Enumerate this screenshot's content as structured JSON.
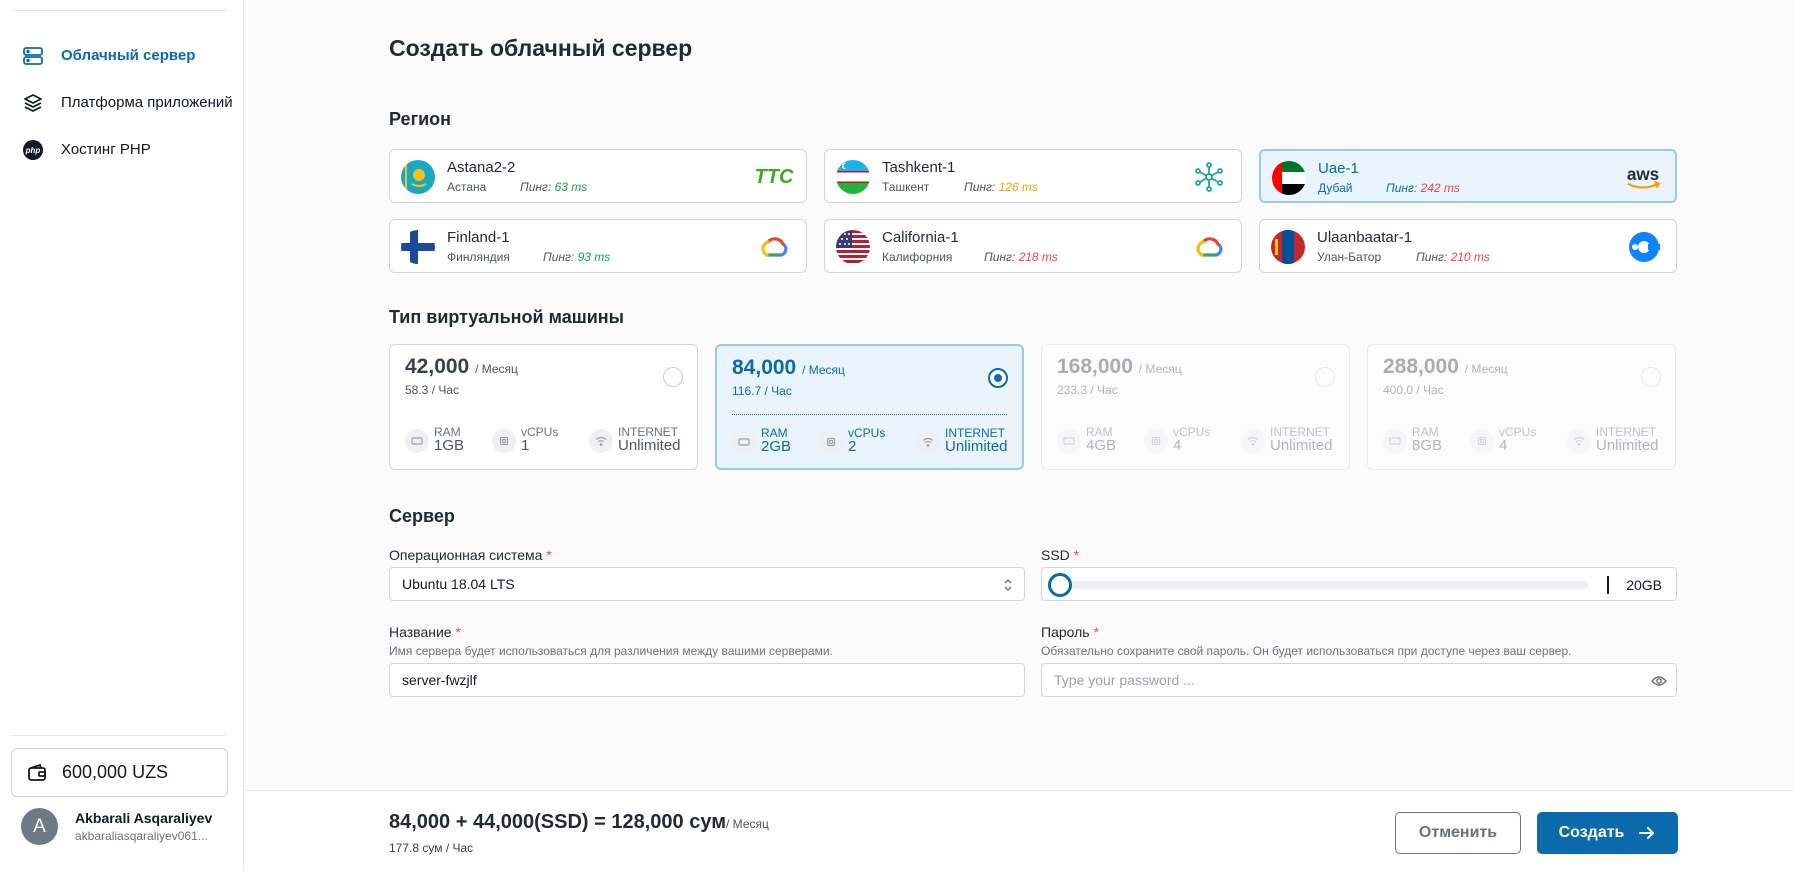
{
  "sidebar": {
    "nav": [
      {
        "label": "Облачный сервер",
        "icon": "server-icon",
        "active": true
      },
      {
        "label": "Платформа приложений",
        "icon": "layers-icon",
        "active": false
      },
      {
        "label": "Хостинг PHP",
        "icon": "php-icon",
        "active": false
      }
    ],
    "balance": "600,000 UZS",
    "user": {
      "initial": "A",
      "name": "Akbarali Asqaraliyev",
      "email": "akbaraliasqaraliyev061..."
    }
  },
  "page": {
    "title": "Создать облачный сервер"
  },
  "region": {
    "heading": "Регион",
    "items": [
      {
        "name": "Astana2-2",
        "city": "Астана",
        "ping_label": "Пинг:",
        "ping": "63 ms",
        "ping_color": "#16a34a",
        "logo": "ttc-logo",
        "selected": false
      },
      {
        "name": "Tashkent-1",
        "city": "Ташкент",
        "ping_label": "Пинг:",
        "ping": "126 ms",
        "ping_color": "#f59e0b",
        "logo": "network-logo",
        "selected": false
      },
      {
        "name": "Uae-1",
        "city": "Дубай",
        "ping_label": "Пинг:",
        "ping": "242 ms",
        "ping_color": "#ef4444",
        "logo": "aws-logo",
        "selected": true
      },
      {
        "name": "Finland-1",
        "city": "Финляндия",
        "ping_label": "Пинг:",
        "ping": "93 ms",
        "ping_color": "#16a34a",
        "logo": "google-cloud-logo",
        "selected": false
      },
      {
        "name": "California-1",
        "city": "Калифорния",
        "ping_label": "Пинг:",
        "ping": "218 ms",
        "ping_color": "#ef4444",
        "logo": "google-cloud-logo",
        "selected": false
      },
      {
        "name": "Ulaanbaatar-1",
        "city": "Улан-Батор",
        "ping_label": "Пинг:",
        "ping": "210 ms",
        "ping_color": "#ef4444",
        "logo": "cloud-c-logo",
        "selected": false
      }
    ]
  },
  "vm": {
    "heading": "Тип виртуальной машины",
    "plans": [
      {
        "price": "42,000",
        "per": "/ Месяц",
        "hour": "58.3 / Час",
        "ram_label": "RAM",
        "ram": "1GB",
        "cpu_label": "vCPUs",
        "cpu": "1",
        "net_label": "INTERNET",
        "net": "Unlimited",
        "state": "normal"
      },
      {
        "price": "84,000",
        "per": "/ Месяц",
        "hour": "116.7 / Час",
        "ram_label": "RAM",
        "ram": "2GB",
        "cpu_label": "vCPUs",
        "cpu": "2",
        "net_label": "INTERNET",
        "net": "Unlimited",
        "state": "selected"
      },
      {
        "price": "168,000",
        "per": "/ Месяц",
        "hour": "233.3 / Час",
        "ram_label": "RAM",
        "ram": "4GB",
        "cpu_label": "vCPUs",
        "cpu": "4",
        "net_label": "INTERNET",
        "net": "Unlimited",
        "state": "disabled"
      },
      {
        "price": "288,000",
        "per": "/ Месяц",
        "hour": "400.0 / Час",
        "ram_label": "RAM",
        "ram": "8GB",
        "cpu_label": "vCPUs",
        "cpu": "4",
        "net_label": "INTERNET",
        "net": "Unlimited",
        "state": "disabled"
      }
    ]
  },
  "server": {
    "heading": "Сервер",
    "os_label": "Операционная система",
    "os_value": "Ubuntu 18.04 LTS",
    "ssd_label": "SSD",
    "ssd_value": "20GB",
    "ssd_level": 0,
    "name_label": "Название",
    "name_hint": "Имя сервера будет использоваться для различения между вашими серверами.",
    "name_value": "server-fwzjlf",
    "password_label": "Пароль",
    "password_hint": "Обязательно сохраните свой пароль. Он будет использоваться при доступе через ваш сервер.",
    "password_placeholder": "Type your password ...",
    "required_mark": "*"
  },
  "footer": {
    "total": "84,000 + 44,000(SSD) = 128,000 сум",
    "total_per": "/ Месяц",
    "hourly": "177.8 сум / Час",
    "cancel": "Отменить",
    "create": "Создать"
  },
  "colors": {
    "accent": "#0b6aab",
    "selected_bg": "#eaf4fc",
    "selected_border": "#9cc8ea"
  }
}
